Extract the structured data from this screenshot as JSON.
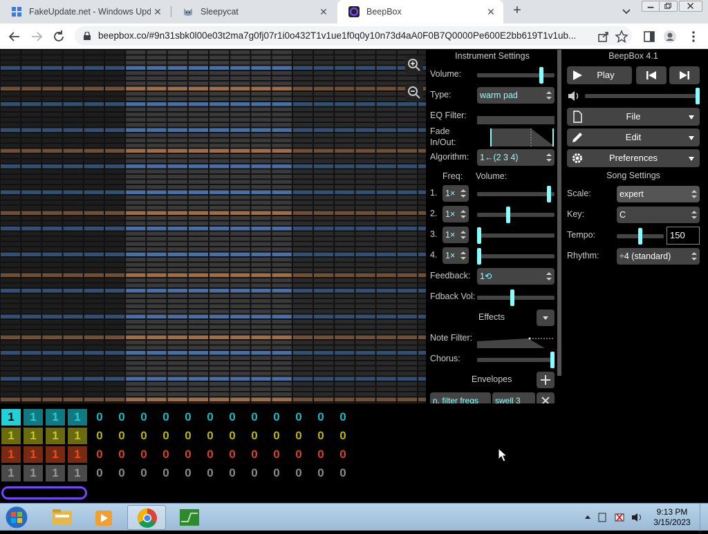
{
  "browser": {
    "tabs": [
      {
        "title": "FakeUpdate.net - Windows Upda",
        "close": "✕"
      },
      {
        "title": "Sleepycat",
        "close": "✕"
      },
      {
        "title": "BeepBox",
        "close": "✕",
        "active": true
      }
    ],
    "new_tab": "+",
    "url": "beepbox.co/#9n31sbk0l00e03t2ma7g0fj07r1i0o432T1v1ue1f0q0y10n73d4aA0F0B7Q0000Pe600E2bb619T1v1ub..."
  },
  "instrument": {
    "title": "Instrument Settings",
    "volume_label": "Volume:",
    "volume_level": 0.85,
    "type_label": "Type:",
    "type_value": "warm pad",
    "eq_label": "EQ Filter:",
    "fade_label": "Fade In/Out:",
    "algorithm_label": "Algorithm:",
    "algorithm_value": "1←(2 3 4)",
    "freq_header": "Freq:",
    "opvol_header": "Volume:",
    "operators": [
      {
        "num": "1.",
        "freq": "1×",
        "volume": 0.95
      },
      {
        "num": "2.",
        "freq": "1×",
        "volume": 0.4
      },
      {
        "num": "3.",
        "freq": "1×",
        "volume": 0.0
      },
      {
        "num": "4.",
        "freq": "1×",
        "volume": 0.0
      }
    ],
    "feedback_label": "Feedback:",
    "feedback_value": "1⟲",
    "fdbackvol_label": "Fdback Vol:",
    "fdbackvol_level": 0.45,
    "effects_label": "Effects",
    "note_filter_label": "Note Filter:",
    "chorus_label": "Chorus:",
    "chorus_level": 1.0,
    "envelopes_label": "Envelopes",
    "envelopes": [
      "n. filter freqs",
      "swell 3"
    ]
  },
  "song": {
    "app_title": "BeepBox 4.1",
    "play_label": "Play",
    "master_volume": 1.0,
    "file_label": "File",
    "edit_label": "Edit",
    "prefs_label": "Preferences",
    "settings_title": "Song Settings",
    "scale_label": "Scale:",
    "scale_value": "expert",
    "key_label": "Key:",
    "key_value": "C",
    "tempo_label": "Tempo:",
    "tempo_value": "150",
    "tempo_level": 0.5,
    "rhythm_label": "Rhythm:",
    "rhythm_value": "÷4 (standard)"
  },
  "tracks": [
    {
      "color": "#22d0d8",
      "dim": "#117a80",
      "cells": [
        "1",
        "1",
        "1",
        "1",
        "0",
        "0",
        "0",
        "0",
        "0",
        "0",
        "0",
        "0",
        "0",
        "0",
        "0",
        "0"
      ]
    },
    {
      "color": "#c8c820",
      "dim": "#6a6a10",
      "cells": [
        "1",
        "1",
        "1",
        "1",
        "0",
        "0",
        "0",
        "0",
        "0",
        "0",
        "0",
        "0",
        "0",
        "0",
        "0",
        "0"
      ]
    },
    {
      "color": "#e85020",
      "dim": "#7a2a10",
      "cells": [
        "1",
        "1",
        "1",
        "1",
        "0",
        "0",
        "0",
        "0",
        "0",
        "0",
        "0",
        "0",
        "0",
        "0",
        "0",
        "0"
      ]
    },
    {
      "color": "#999999",
      "dim": "#4a4a4a",
      "cells": [
        "1",
        "1",
        "1",
        "1",
        "0",
        "0",
        "0",
        "0",
        "0",
        "0",
        "0",
        "0",
        "0",
        "0",
        "0",
        "0"
      ]
    }
  ],
  "taskbar": {
    "time": "9:13 PM",
    "date": "3/15/2023"
  },
  "colors": {
    "accent": "#88ffff",
    "panel": "#444444"
  }
}
